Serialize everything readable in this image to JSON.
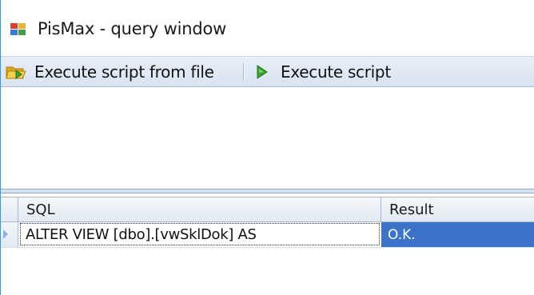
{
  "window": {
    "title": "PisMax - query window"
  },
  "toolbar": {
    "execute_from_file_label": "Execute script from file",
    "execute_label": "Execute script"
  },
  "editor": {
    "content": ""
  },
  "grid": {
    "columns": [
      "SQL",
      "Result"
    ],
    "rows": [
      {
        "sql": "ALTER VIEW [dbo].[vwSklDok] AS",
        "result": "O.K."
      }
    ]
  },
  "colors": {
    "selection": "#3a73c9",
    "toolbar": "#dfe8f3",
    "icon_play": "#3aa12e",
    "icon_folder": "#f2c233"
  },
  "icons": {
    "app": "pismax-app-icon",
    "execute_from_file": "folder-open-arrow-icon",
    "execute": "play-icon",
    "row_indicator": "row-pointer-icon"
  }
}
